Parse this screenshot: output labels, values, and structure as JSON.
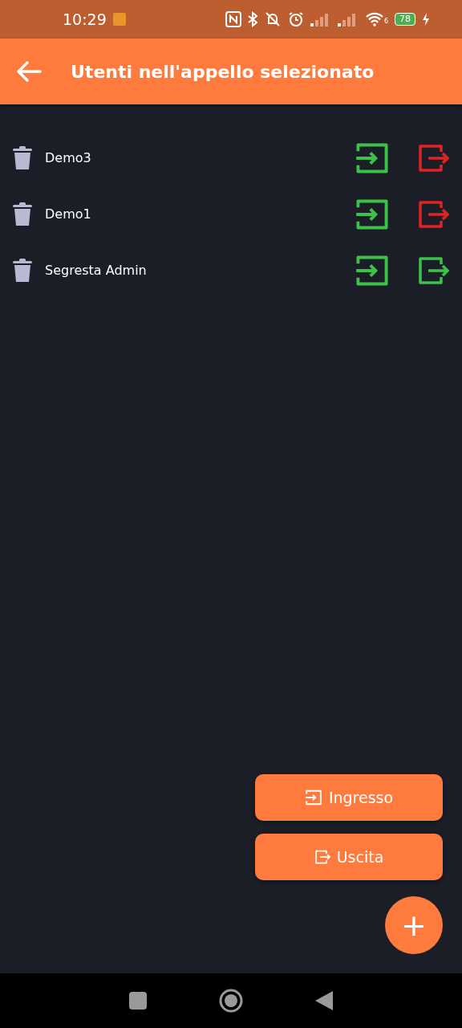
{
  "status_bar": {
    "time": "10:29",
    "wifi_badge": "6",
    "battery": "78"
  },
  "app_bar": {
    "title": "Utenti nell'appello selezionato"
  },
  "users": [
    {
      "name": "Demo3",
      "entered": true,
      "exited": false
    },
    {
      "name": "Demo1",
      "entered": true,
      "exited": false
    },
    {
      "name": "Segresta Admin",
      "entered": true,
      "exited": true
    }
  ],
  "actions": [
    {
      "kind": "entry",
      "label": "Ingresso"
    },
    {
      "kind": "exit",
      "label": "Uscita"
    }
  ],
  "fab": {
    "label": "+"
  }
}
